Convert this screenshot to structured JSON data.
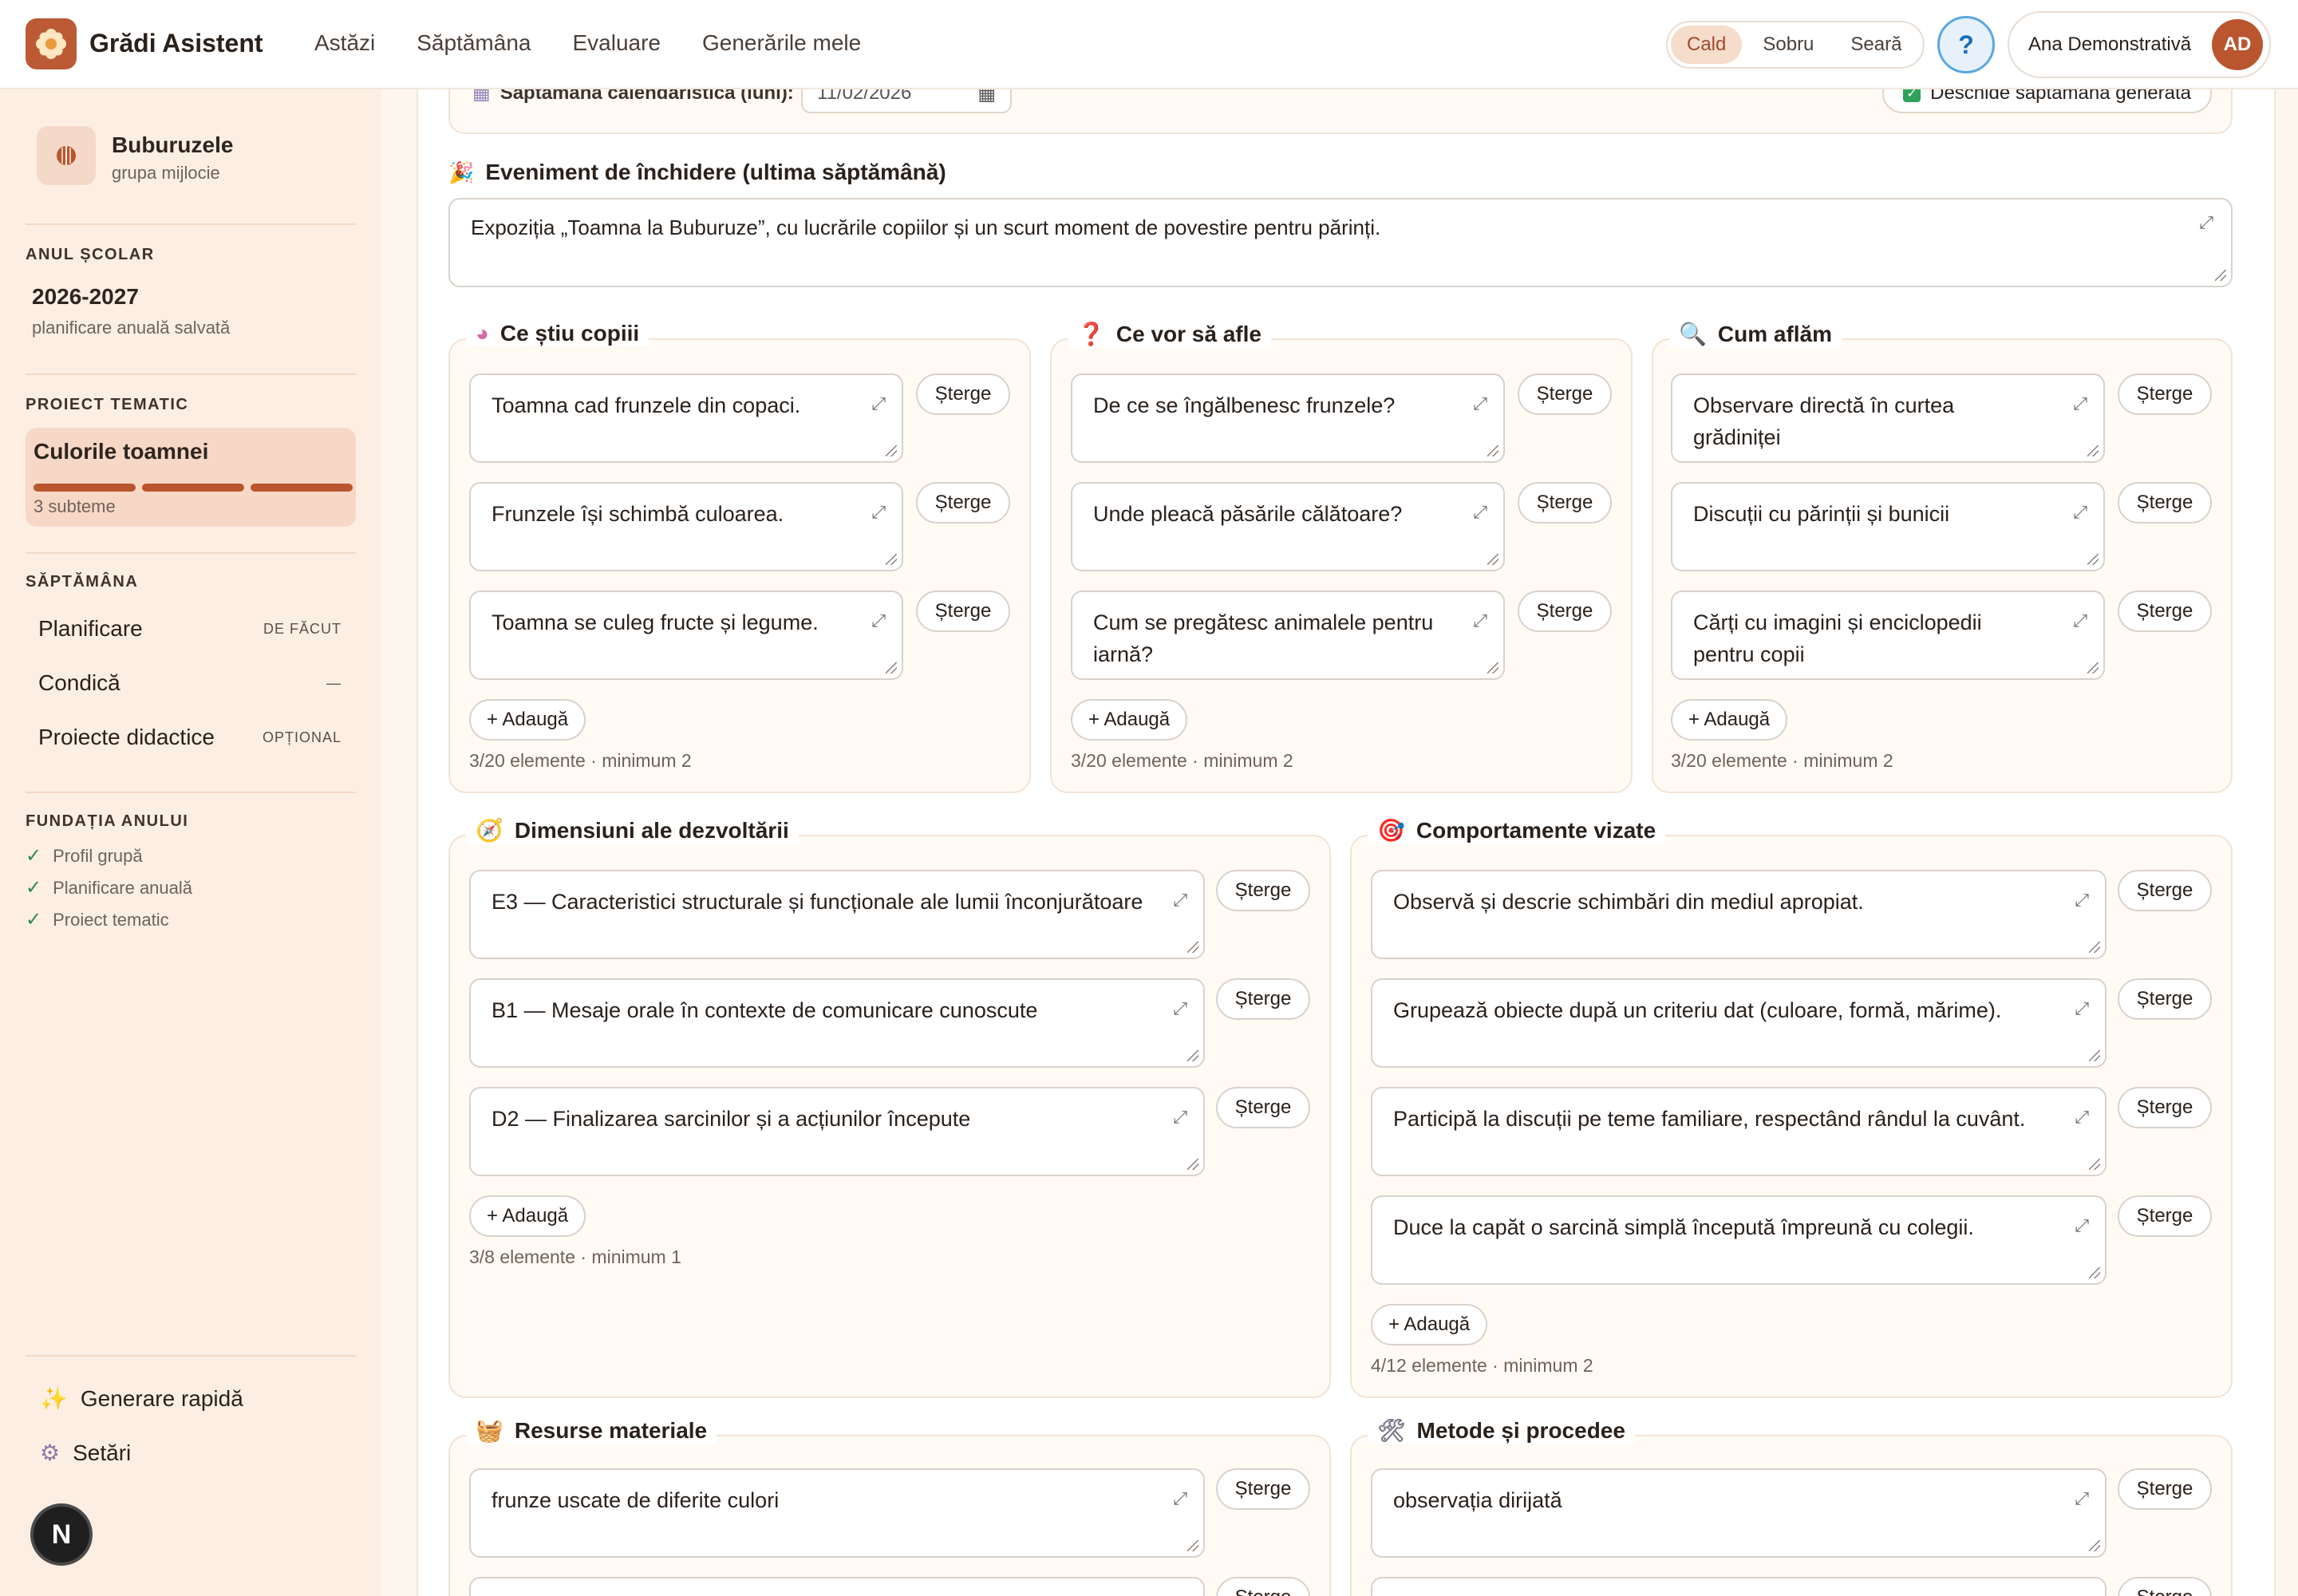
{
  "app": {
    "title": "Grădi Asistent",
    "logo_icon": "flower-icon"
  },
  "topnav": [
    "Astăzi",
    "Săptămâna",
    "Evaluare",
    "Generările mele"
  ],
  "theme": {
    "options": [
      "Cald",
      "Sobru",
      "Seară"
    ],
    "active": "Cald"
  },
  "help_label": "?",
  "user": {
    "name": "Ana Demonstrativă",
    "initials": "AD"
  },
  "sidebar": {
    "group": {
      "name": "Buburuzele",
      "subtitle": "grupa mijlocie"
    },
    "year_heading": "ANUL ȘCOLAR",
    "year_value": "2026-2027",
    "year_sub": "planificare anuală salvată",
    "project_heading": "PROIECT TEMATIC",
    "project": {
      "name": "Culorile toamnei",
      "subthemes": "3 subteme",
      "progress_segments": 3
    },
    "week_heading": "SĂPTĂMÂNA",
    "week_items": [
      {
        "label": "Planificare",
        "status": "DE FĂCUT"
      },
      {
        "label": "Condică",
        "status": "—"
      },
      {
        "label": "Proiecte didactice",
        "status": "OPȚIONAL"
      }
    ],
    "foundation_heading": "FUNDAȚIA ANULUI",
    "foundation_items": [
      "Profil grupă",
      "Planificare anuală",
      "Proiect tematic"
    ],
    "bottom_links": [
      {
        "label": "Generare rapidă",
        "icon": "sparkles-icon"
      },
      {
        "label": "Setări",
        "icon": "gear-icon"
      }
    ],
    "badge": "N"
  },
  "week_row": {
    "label": "Săptămâna calendaristică (luni):",
    "date_value": "11/02/2026",
    "open_label": "Deschide săptămâna generată"
  },
  "closing_event": {
    "label": "Eveniment de închidere (ultima săptămână)",
    "value": "Expoziția „Toamna la Buburuze”, cu lucrările copiilor și un scurt moment de povestire pentru părinți."
  },
  "delete_label": "Șterge",
  "add_label": "+ Adaugă",
  "sections": {
    "know": {
      "title": "Ce știu copiii",
      "icon": "brain-icon",
      "items": [
        "Toamna cad frunzele din copaci.",
        "Frunzele își schimbă culoarea.",
        "Toamna se culeg fructe și legume."
      ],
      "counter": "3/20 elemente · minimum 2"
    },
    "want": {
      "title": "Ce vor să afle",
      "icon": "question-icon",
      "items": [
        "De ce se îngălbenesc frunzele?",
        "Unde pleacă păsările călătoare?",
        "Cum se pregătesc animalele pentru iarnă?"
      ],
      "counter": "3/20 elemente · minimum 2"
    },
    "how": {
      "title": "Cum aflăm",
      "icon": "magnifier-icon",
      "items": [
        "Observare directă în curtea grădiniței",
        "Discuții cu părinții și bunicii",
        "Cărți cu imagini și enciclopedii pentru copii"
      ],
      "counter": "3/20 elemente · minimum 2"
    },
    "dimensions": {
      "title": "Dimensiuni ale dezvoltării",
      "icon": "compass-icon",
      "items": [
        "E3 — Caracteristici structurale și funcționale ale lumii înconjurătoare",
        "B1 — Mesaje orale în contexte de comunicare cunoscute",
        "D2 — Finalizarea sarcinilor și a acțiunilor începute"
      ],
      "counter": "3/8 elemente · minimum 1"
    },
    "behaviours": {
      "title": "Comportamente vizate",
      "icon": "target-icon",
      "items": [
        "Observă și descrie schimbări din mediul apropiat.",
        "Grupează obiecte după un criteriu dat (culoare, formă, mărime).",
        "Participă la discuții pe teme familiare, respectând rândul la cuvânt.",
        "Duce la capăt o sarcină simplă începută împreună cu colegii."
      ],
      "counter": "4/12 elemente · minimum 2"
    },
    "resources": {
      "title": "Resurse materiale",
      "icon": "basket-icon",
      "items": [
        "frunze uscate de diferite culori"
      ]
    },
    "methods": {
      "title": "Metode și procedee",
      "icon": "tools-icon",
      "items": [
        "observația dirijată"
      ]
    }
  }
}
